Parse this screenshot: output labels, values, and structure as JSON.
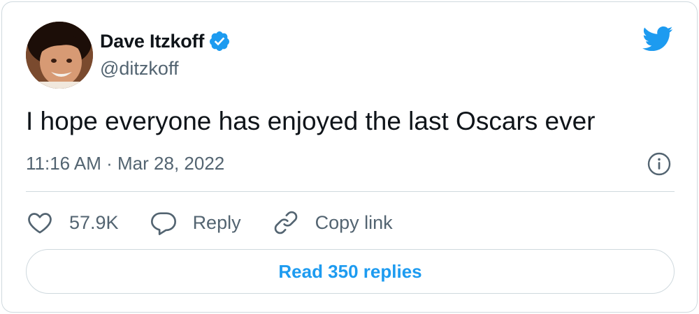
{
  "author": {
    "display_name": "Dave Itzkoff",
    "handle": "@ditzkoff",
    "verified": true
  },
  "tweet": {
    "text": "I hope everyone has enjoyed the last Oscars ever",
    "timestamp": "11:16 AM · Mar 28, 2022"
  },
  "actions": {
    "like_count": "57.9K",
    "reply_label": "Reply",
    "copy_link_label": "Copy link"
  },
  "footer": {
    "read_replies_label": "Read 350 replies"
  },
  "colors": {
    "brand": "#1d9bf0",
    "text_primary": "#0f1419",
    "text_secondary": "#536471",
    "border": "#cfd9de"
  },
  "icons": {
    "logo": "twitter-bird-icon",
    "verified": "verified-badge-icon",
    "info": "info-icon",
    "like": "heart-icon",
    "reply": "speech-bubble-icon",
    "copy_link": "link-icon"
  }
}
